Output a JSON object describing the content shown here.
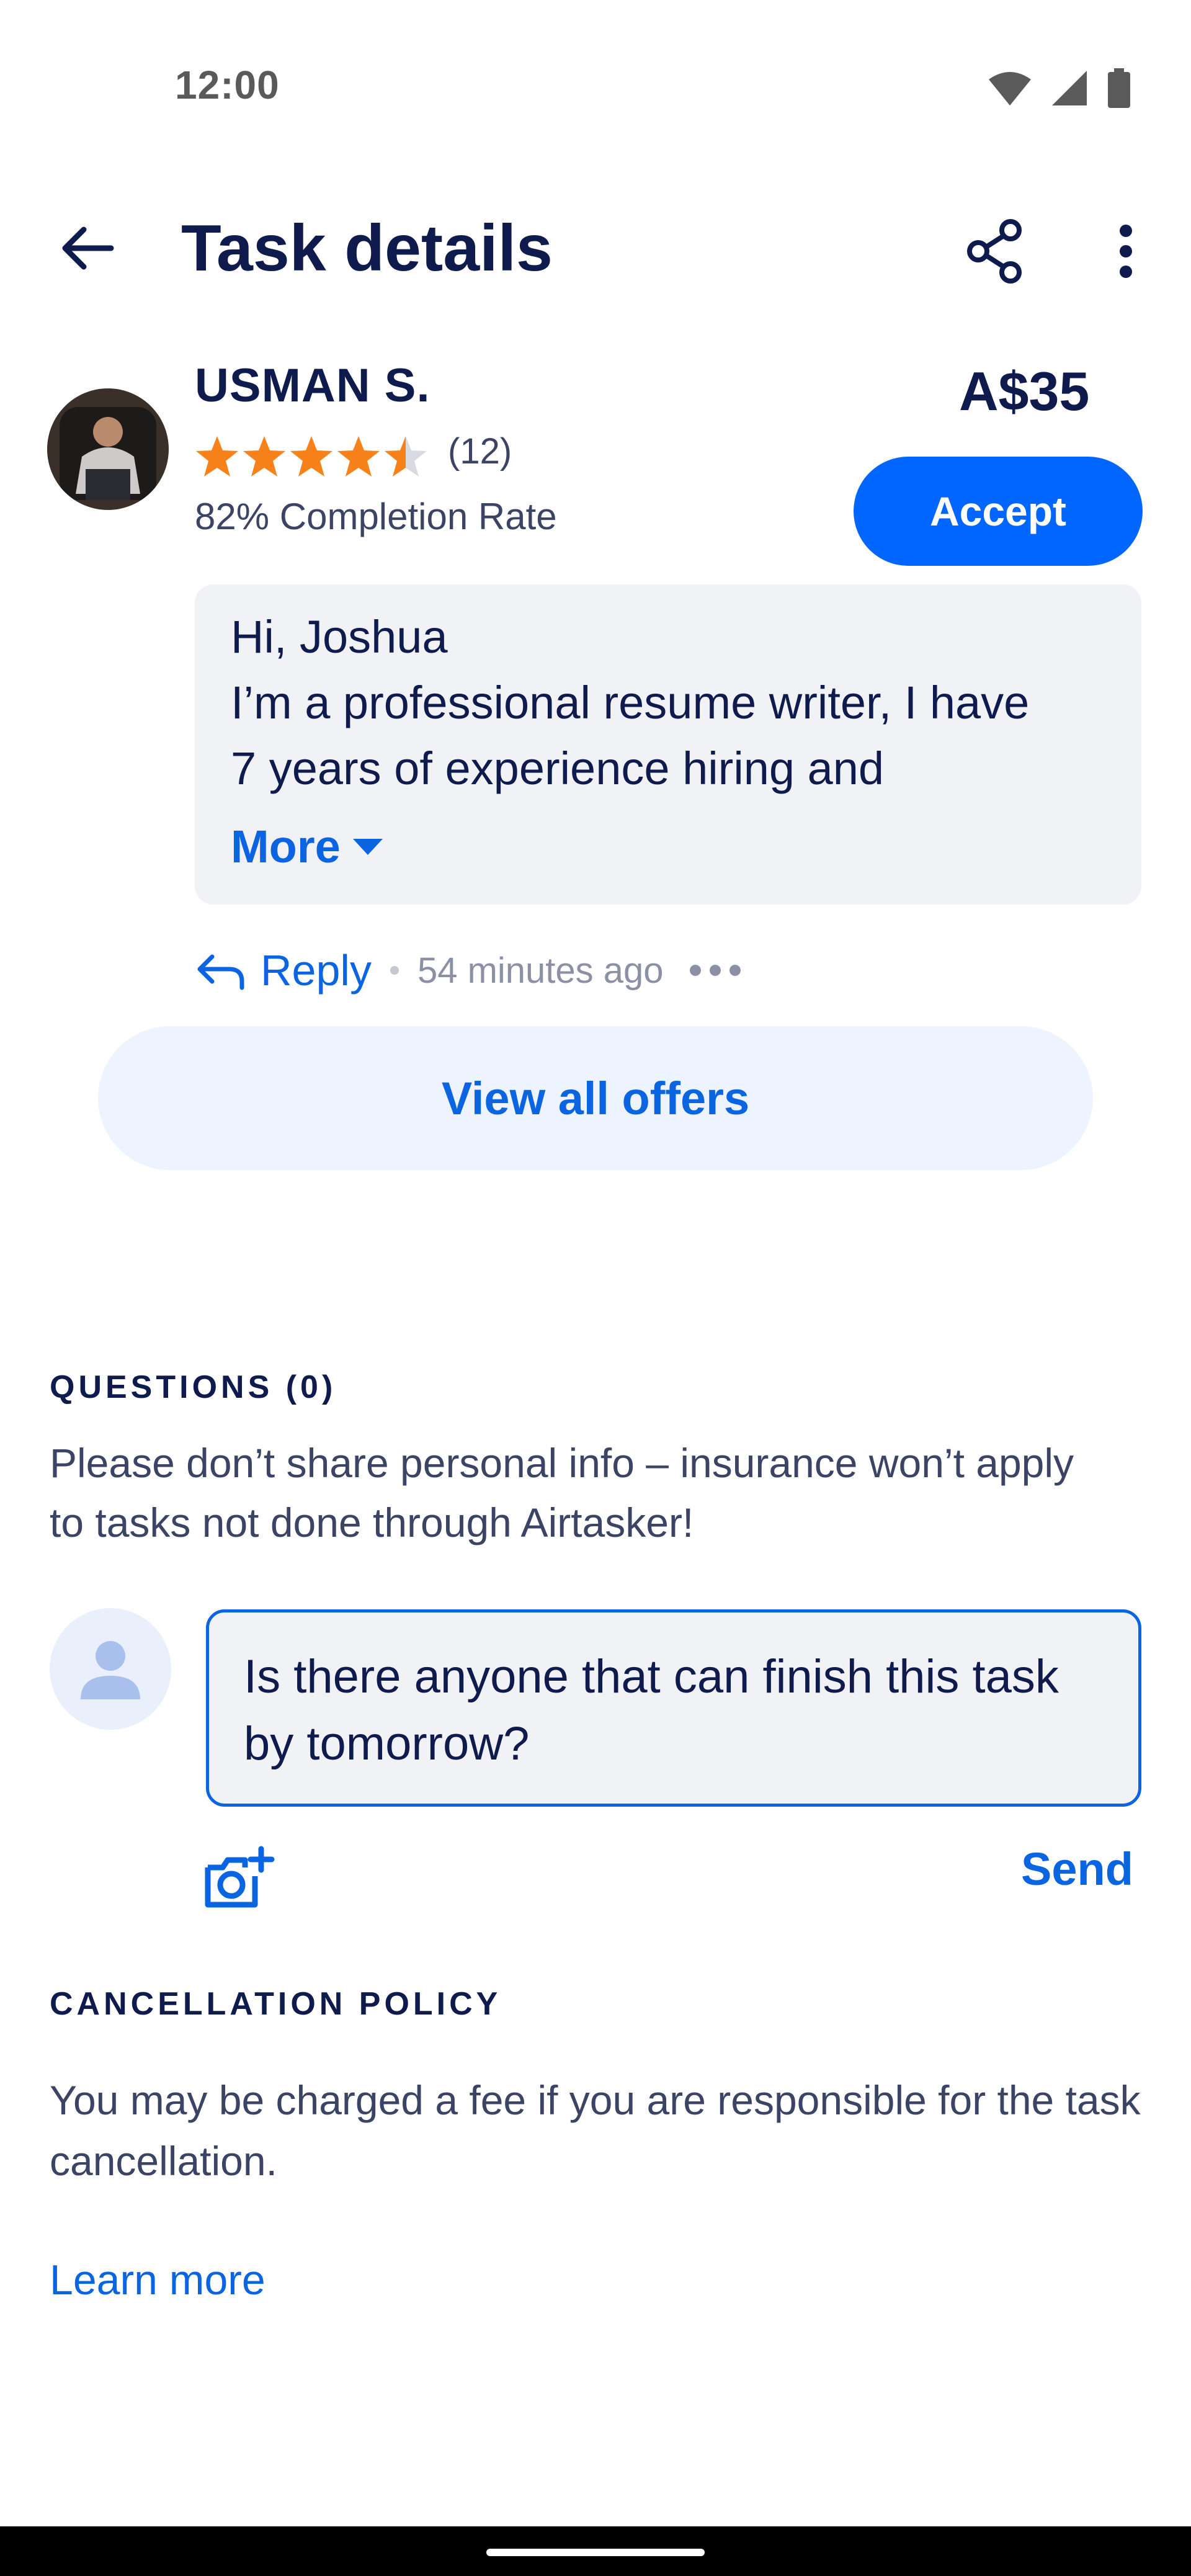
{
  "status_bar": {
    "time": "12:00",
    "icons": [
      "wifi-icon",
      "signal-icon",
      "battery-icon"
    ]
  },
  "app_bar": {
    "title": "Task details",
    "icons": [
      "back-arrow-icon",
      "share-icon",
      "more-vert-icon"
    ]
  },
  "offer": {
    "name": "USMAN S.",
    "rating": 4.5,
    "rating_max": 5,
    "rating_count": "(12)",
    "completion_rate": "82% Completion Rate",
    "price": "A$35",
    "accept_label": "Accept",
    "message_lines": [
      "Hi, Joshua",
      "I’m a professional resume writer, I have",
      "7 years of experience hiring and"
    ],
    "more_label": "More",
    "reply_label": "Reply",
    "time_ago": "54 minutes ago"
  },
  "view_all_offers_label": "View all offers",
  "questions": {
    "heading": "QUESTIONS (0)",
    "info": "Please don’t share personal info – insurance won’t apply to tasks not done through Airtasker!",
    "input_value": "Is there anyone that can finish this task by tomorrow?",
    "send_label": "Send"
  },
  "cancellation": {
    "heading": "CANCELLATION POLICY",
    "text": "You may be charged a fee if you are responsible for the task cancellation.",
    "learn_more_label": "Learn more"
  },
  "colors": {
    "accent": "#0066ff",
    "link": "#0b64e0",
    "star": "#f7821b",
    "text_primary": "#0f1b4c"
  }
}
